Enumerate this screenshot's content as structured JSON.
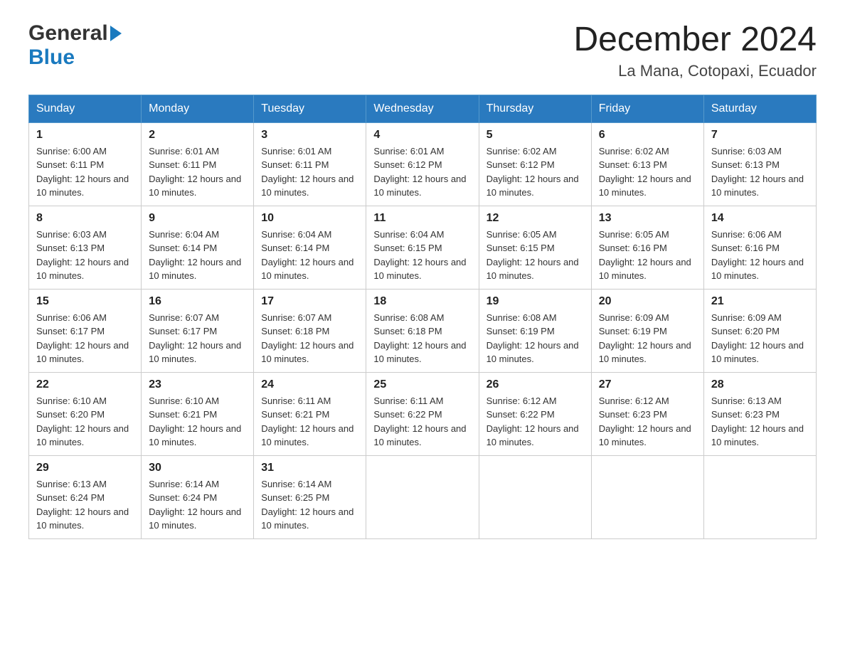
{
  "header": {
    "logo": {
      "text_general": "General",
      "text_blue": "Blue"
    },
    "title": "December 2024",
    "subtitle": "La Mana, Cotopaxi, Ecuador"
  },
  "days_of_week": [
    "Sunday",
    "Monday",
    "Tuesday",
    "Wednesday",
    "Thursday",
    "Friday",
    "Saturday"
  ],
  "weeks": [
    [
      {
        "day": "1",
        "sunrise": "6:00 AM",
        "sunset": "6:11 PM",
        "daylight": "12 hours and 10 minutes."
      },
      {
        "day": "2",
        "sunrise": "6:01 AM",
        "sunset": "6:11 PM",
        "daylight": "12 hours and 10 minutes."
      },
      {
        "day": "3",
        "sunrise": "6:01 AM",
        "sunset": "6:11 PM",
        "daylight": "12 hours and 10 minutes."
      },
      {
        "day": "4",
        "sunrise": "6:01 AM",
        "sunset": "6:12 PM",
        "daylight": "12 hours and 10 minutes."
      },
      {
        "day": "5",
        "sunrise": "6:02 AM",
        "sunset": "6:12 PM",
        "daylight": "12 hours and 10 minutes."
      },
      {
        "day": "6",
        "sunrise": "6:02 AM",
        "sunset": "6:13 PM",
        "daylight": "12 hours and 10 minutes."
      },
      {
        "day": "7",
        "sunrise": "6:03 AM",
        "sunset": "6:13 PM",
        "daylight": "12 hours and 10 minutes."
      }
    ],
    [
      {
        "day": "8",
        "sunrise": "6:03 AM",
        "sunset": "6:13 PM",
        "daylight": "12 hours and 10 minutes."
      },
      {
        "day": "9",
        "sunrise": "6:04 AM",
        "sunset": "6:14 PM",
        "daylight": "12 hours and 10 minutes."
      },
      {
        "day": "10",
        "sunrise": "6:04 AM",
        "sunset": "6:14 PM",
        "daylight": "12 hours and 10 minutes."
      },
      {
        "day": "11",
        "sunrise": "6:04 AM",
        "sunset": "6:15 PM",
        "daylight": "12 hours and 10 minutes."
      },
      {
        "day": "12",
        "sunrise": "6:05 AM",
        "sunset": "6:15 PM",
        "daylight": "12 hours and 10 minutes."
      },
      {
        "day": "13",
        "sunrise": "6:05 AM",
        "sunset": "6:16 PM",
        "daylight": "12 hours and 10 minutes."
      },
      {
        "day": "14",
        "sunrise": "6:06 AM",
        "sunset": "6:16 PM",
        "daylight": "12 hours and 10 minutes."
      }
    ],
    [
      {
        "day": "15",
        "sunrise": "6:06 AM",
        "sunset": "6:17 PM",
        "daylight": "12 hours and 10 minutes."
      },
      {
        "day": "16",
        "sunrise": "6:07 AM",
        "sunset": "6:17 PM",
        "daylight": "12 hours and 10 minutes."
      },
      {
        "day": "17",
        "sunrise": "6:07 AM",
        "sunset": "6:18 PM",
        "daylight": "12 hours and 10 minutes."
      },
      {
        "day": "18",
        "sunrise": "6:08 AM",
        "sunset": "6:18 PM",
        "daylight": "12 hours and 10 minutes."
      },
      {
        "day": "19",
        "sunrise": "6:08 AM",
        "sunset": "6:19 PM",
        "daylight": "12 hours and 10 minutes."
      },
      {
        "day": "20",
        "sunrise": "6:09 AM",
        "sunset": "6:19 PM",
        "daylight": "12 hours and 10 minutes."
      },
      {
        "day": "21",
        "sunrise": "6:09 AM",
        "sunset": "6:20 PM",
        "daylight": "12 hours and 10 minutes."
      }
    ],
    [
      {
        "day": "22",
        "sunrise": "6:10 AM",
        "sunset": "6:20 PM",
        "daylight": "12 hours and 10 minutes."
      },
      {
        "day": "23",
        "sunrise": "6:10 AM",
        "sunset": "6:21 PM",
        "daylight": "12 hours and 10 minutes."
      },
      {
        "day": "24",
        "sunrise": "6:11 AM",
        "sunset": "6:21 PM",
        "daylight": "12 hours and 10 minutes."
      },
      {
        "day": "25",
        "sunrise": "6:11 AM",
        "sunset": "6:22 PM",
        "daylight": "12 hours and 10 minutes."
      },
      {
        "day": "26",
        "sunrise": "6:12 AM",
        "sunset": "6:22 PM",
        "daylight": "12 hours and 10 minutes."
      },
      {
        "day": "27",
        "sunrise": "6:12 AM",
        "sunset": "6:23 PM",
        "daylight": "12 hours and 10 minutes."
      },
      {
        "day": "28",
        "sunrise": "6:13 AM",
        "sunset": "6:23 PM",
        "daylight": "12 hours and 10 minutes."
      }
    ],
    [
      {
        "day": "29",
        "sunrise": "6:13 AM",
        "sunset": "6:24 PM",
        "daylight": "12 hours and 10 minutes."
      },
      {
        "day": "30",
        "sunrise": "6:14 AM",
        "sunset": "6:24 PM",
        "daylight": "12 hours and 10 minutes."
      },
      {
        "day": "31",
        "sunrise": "6:14 AM",
        "sunset": "6:25 PM",
        "daylight": "12 hours and 10 minutes."
      },
      null,
      null,
      null,
      null
    ]
  ]
}
